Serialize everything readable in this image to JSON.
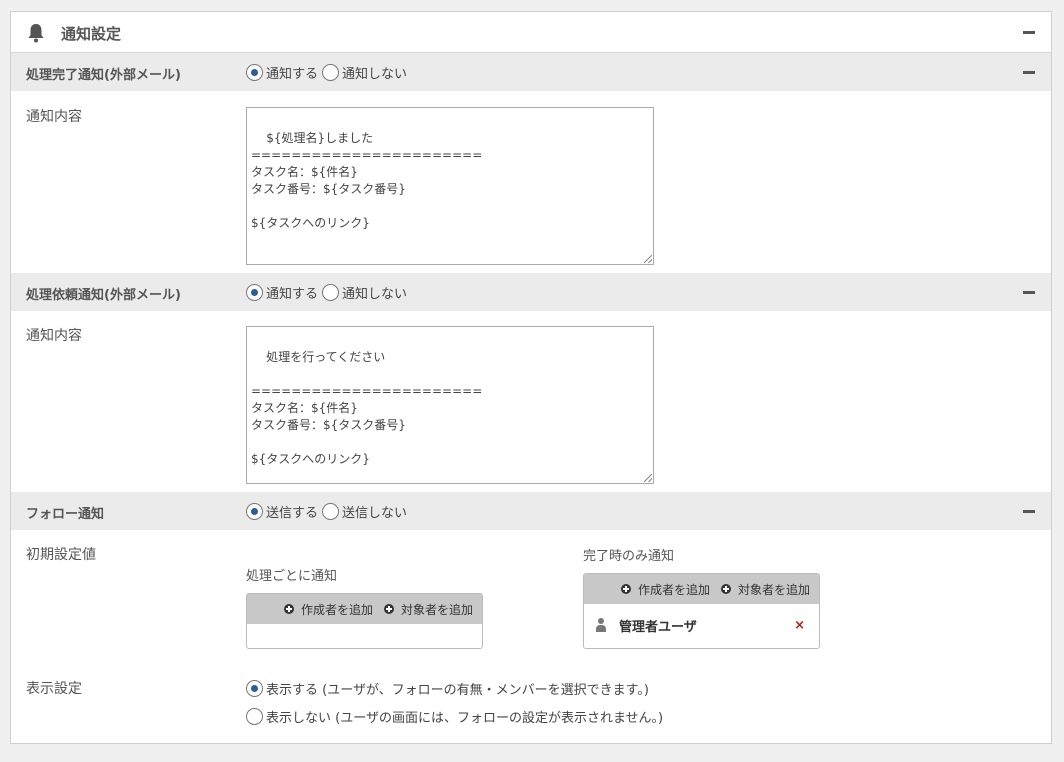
{
  "panel": {
    "title": "通知設定",
    "icon": "bell-icon"
  },
  "sections": [
    {
      "label": "処理完了通知(外部メール)",
      "options": [
        "通知する",
        "通知しない"
      ],
      "selected": 0,
      "content_label": "通知内容",
      "content": "${処理名}しました\n=======================\nタスク名：${件名}\nタスク番号：${タスク番号}\n\n${タスクへのリンク}"
    },
    {
      "label": "処理依頼通知(外部メール)",
      "options": [
        "通知する",
        "通知しない"
      ],
      "selected": 0,
      "content_label": "通知内容",
      "content": "処理を行ってください\n\n=======================\nタスク名：${件名}\nタスク番号：${タスク番号}\n\n${タスクへのリンク}"
    }
  ],
  "follow": {
    "label": "フォロー通知",
    "options": [
      "送信する",
      "送信しない"
    ],
    "selected": 0,
    "default_label": "初期設定値",
    "per_process": {
      "label": "処理ごとに通知",
      "add_creator": "作成者を追加",
      "add_target": "対象者を追加"
    },
    "on_complete": {
      "label": "完了時のみ通知",
      "add_creator": "作成者を追加",
      "add_target": "対象者を追加",
      "users": [
        {
          "name": "管理者ユーザ",
          "remove": "×"
        }
      ]
    },
    "display_label": "表示設定",
    "display_options": [
      "表示する (ユーザが、フォローの有無・メンバーを選択できます。)",
      "表示しない (ユーザの画面には、フォローの設定が表示されません。)"
    ],
    "display_selected": 0
  }
}
